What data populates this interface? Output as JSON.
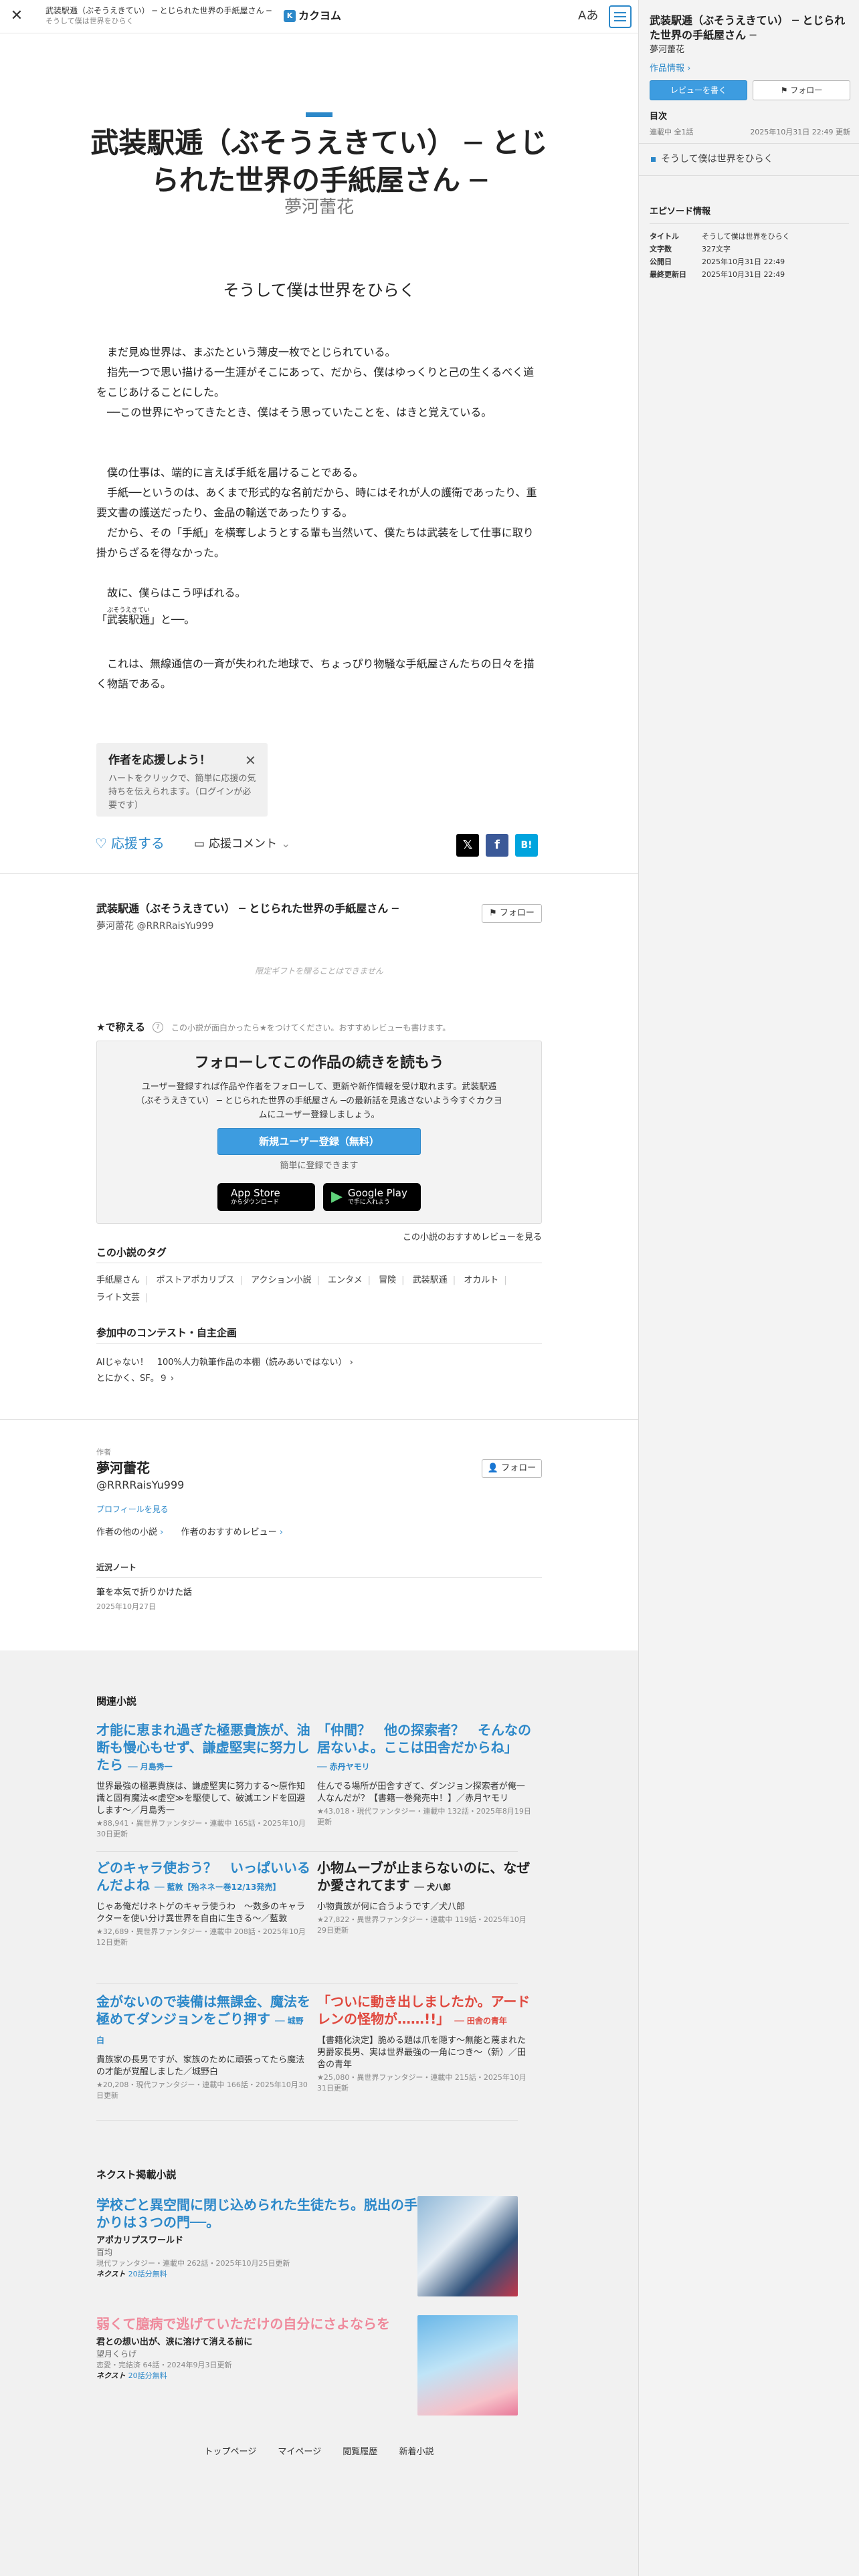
{
  "header": {
    "work_title": "武装駅逓（ぶそうえきてい） ─ とじられた世界の手紙屋さん ─",
    "episode_title": "そうして僕は世界をひらく",
    "logo_text": "カクヨム",
    "font_button": "Aあ"
  },
  "work": {
    "title": "武装駅逓（ぶそうえきてい） ─ とじられた世界の手紙屋さん ─",
    "author": "夢河蕾花",
    "author_id": "@RRRRaisYu999"
  },
  "episode": {
    "title": "そうして僕は世界をひらく",
    "paragraphs": [
      "　まだ見ぬ世界は、まぶたという薄皮一枚でとじられている。",
      "　指先一つで思い描ける一生涯がそこにあって、だから、僕はゆっくりと己の生くるべく道をこじあけることにした。",
      "　──この世界にやってきたとき、僕はそう思っていたことを、はきと覚えている。",
      "",
      "",
      "　僕の仕事は、端的に言えば手紙を届けることである。",
      "　手紙──というのは、あくまで形式的な名前だから、時にはそれが人の護衛であったり、重要文書の護送だったり、金品の輸送であったりする。",
      "　だから、その「手紙」を横奪しようとする輩も当然いて、僕たちは武装をして仕事に取り掛からざるを得なかった。",
      "",
      "　故に、僕らはこう呼ばれる。"
    ],
    "ruby_line_prefix": "「",
    "ruby_base": "武装駅逓",
    "ruby_text": "ぶそうえきてい",
    "ruby_line_suffix": "」と──。",
    "last_paragraph_dotted": "これは、無線通信の一斉が失われた地球で",
    "last_paragraph_rest": "　これは、無線通信の一斉が失われた地球で、ちょっぴり物騒な手紙屋さんたちの日々を描く物語である。"
  },
  "cheer": {
    "heading": "作者を応援しよう！",
    "close": "✕",
    "text": "ハートをクリックで、簡単に応援の気持ちを伝えられます。（ログインが必要です）"
  },
  "actions": {
    "like_label": "応援する",
    "comment_label": "応援コメント",
    "share_x": "𝕏",
    "share_fb": "f",
    "share_hatena": "B!"
  },
  "work_block": {
    "follow_label": "フォロー",
    "gift_note": "限定ギフトを贈ることはできません",
    "stars_label": "★で称える",
    "stars_hint": "この小説が面白かったら★をつけてください。おすすめレビューも書けます。",
    "follow_box": {
      "heading": "フォローしてこの作品の続きを読もう",
      "text": "ユーザー登録すれば作品や作者をフォローして、更新や新作情報を受け取れます。武装駅逓（ぶそうえきてい） ─ とじられた世界の手紙屋さん ─の最新話を見逃さないよう今すぐカクヨムにユーザー登録しましょう。",
      "register_label": "新規ユーザー登録（無料）",
      "easy_label": "簡単に登録できます",
      "appstore_l1": "App Store",
      "appstore_l2": "からダウンロード",
      "gplay_l1": "Google Play",
      "gplay_l2": "で手に入れよう"
    },
    "review_link": "この小説のおすすめレビューを見る",
    "tags_heading": "この小説のタグ",
    "tags": [
      "手紙屋さん",
      "ポストアポカリプス",
      "アクション小説",
      "エンタメ",
      "冒険",
      "武装駅逓",
      "オカルト",
      "ライト文芸"
    ],
    "contest_heading": "参加中のコンテスト・自主企画",
    "contests": [
      "AIじゃない！　100%人力執筆作品の本棚（読みあいではない）",
      "とにかく、SF。９"
    ]
  },
  "author_block": {
    "label": "作者",
    "name": "夢河蕾花",
    "id": "@RRRRaisYu999",
    "follow_label": "フォロー",
    "profile_link": "プロフィールを見る",
    "other_works": "作者の他の小説",
    "reviews": "作者のおすすめレビュー",
    "note_heading": "近況ノート",
    "note_title": "筆を本気で折りかけた話",
    "note_date": "2025年10月27日"
  },
  "related": {
    "heading": "関連小説",
    "items": [
      {
        "title": "才能に恵まれ過ぎた極悪貴族が、油断も慢心もせず、謙虚堅実に努力したら",
        "by": "── 月島秀一",
        "desc": "世界最強の極悪貴族は、謙虚堅実に努力する〜原作知識と固有魔法≪虚空≫を駆使して、破滅エンドを回避します〜／月島秀一",
        "meta": "★88,941・異世界ファンタジー・連載中 165話・2025年10月30日更新",
        "color": "blue"
      },
      {
        "title": "「仲間？　他の探索者？　そんなの居ないよ。ここは田舎だからね」",
        "by": "── 赤丹ヤモリ",
        "desc": "住んでる場所が田舎すぎて、ダンジョン探索者が俺一人なんだが？【書籍一巻発売中！】／赤月ヤモリ",
        "meta": "★43,018・現代ファンタジー・連載中 132話・2025年8月19日更新",
        "color": "blue"
      },
      {
        "title": "どのキャラ使おう？　いっぱいいるんだよね",
        "by": "── 藍敦【殆ネネー巻12/13発売】",
        "desc": "じゃあ俺だけネトゲのキャラ使うわ　〜数多のキャラクターを使い分け異世界を自由に生きる〜／藍敦",
        "meta": "★32,689・異世界ファンタジー・連載中 208話・2025年10月12日更新",
        "color": "blue"
      },
      {
        "title": "小物ムーブが止まらないのに、なぜか愛されてます",
        "by": "── 犬八郎",
        "desc": "小物貴族が何に合うようです／犬八郎",
        "meta": "★27,822・異世界ファンタジー・連載中 119話・2025年10月29日更新",
        "color": "black"
      },
      {
        "title": "金がないので装備は無課金、魔法を極めてダンジョンをごり押す",
        "by": "── 城野白",
        "desc": "貴族家の長男ですが、家族のために頑張ってたら魔法の才能が覚醒しました／城野白",
        "meta": "★20,208・現代ファンタジー・連載中 166話・2025年10月30日更新",
        "color": "blue"
      },
      {
        "title": "「ついに動き出しましたか。アードレンの怪物が……!!」",
        "by": "── 田舎の青年",
        "desc": "【書籍化決定】脆める題は爪を隠す〜無能と蔑まれた男爵家長男、実は世界最強の一角につき〜（新）／田舎の青年",
        "meta": "★25,080・異世界ファンタジー・連載中 215話・2025年10月31日更新",
        "color": "red"
      }
    ]
  },
  "next": {
    "heading": "ネクスト掲載小説",
    "items": [
      {
        "title": "学校ごと異空間に閉じ込められた生徒たち。脱出の手がかりは３つの門──。",
        "desc": "アポカリプスワールド",
        "author": "百均",
        "meta": "現代ファンタジー・連載中 262話・2025年10月25日更新",
        "badge_logo": "ネクスト",
        "badge": "20話分無料",
        "color": "blue"
      },
      {
        "title": "弱くて臆病で逃げていただけの自分にさよならを",
        "desc": "君との想い出が、涙に溶けて消える前に",
        "author": "望月くらげ",
        "meta": "恋愛・完結済 64話・2024年9月3日更新",
        "badge_logo": "ネクスト",
        "badge": "20話分無料",
        "color": "pink"
      }
    ]
  },
  "footer": {
    "links": [
      "トップページ",
      "マイページ",
      "閲覧履歴",
      "新着小説"
    ]
  },
  "side": {
    "title": "武装駅逓（ぶそうえきてい） ─ とじられた世界の手紙屋さん ─",
    "author": "夢河蕾花",
    "work_info_link": "作品情報",
    "review_button": "レビューを書く",
    "follow_button": "フォロー",
    "toc_heading": "目次",
    "toc_meta_left": "連載中 全1話",
    "toc_meta_right": "2025年10月31日 22:49 更新",
    "episode": "そうして僕は世界をひらく",
    "info_heading": "エピソード情報",
    "info": [
      {
        "k": "タイトル",
        "v": "そうして僕は世界をひらく"
      },
      {
        "k": "文字数",
        "v": "327文字"
      },
      {
        "k": "公開日",
        "v": "2025年10月31日 22:49"
      },
      {
        "k": "最終更新日",
        "v": "2025年10月31日 22:49"
      }
    ]
  },
  "colors": {
    "accent": "#2c88c9",
    "red": "#e0483e",
    "pink": "#ef8a9c"
  }
}
